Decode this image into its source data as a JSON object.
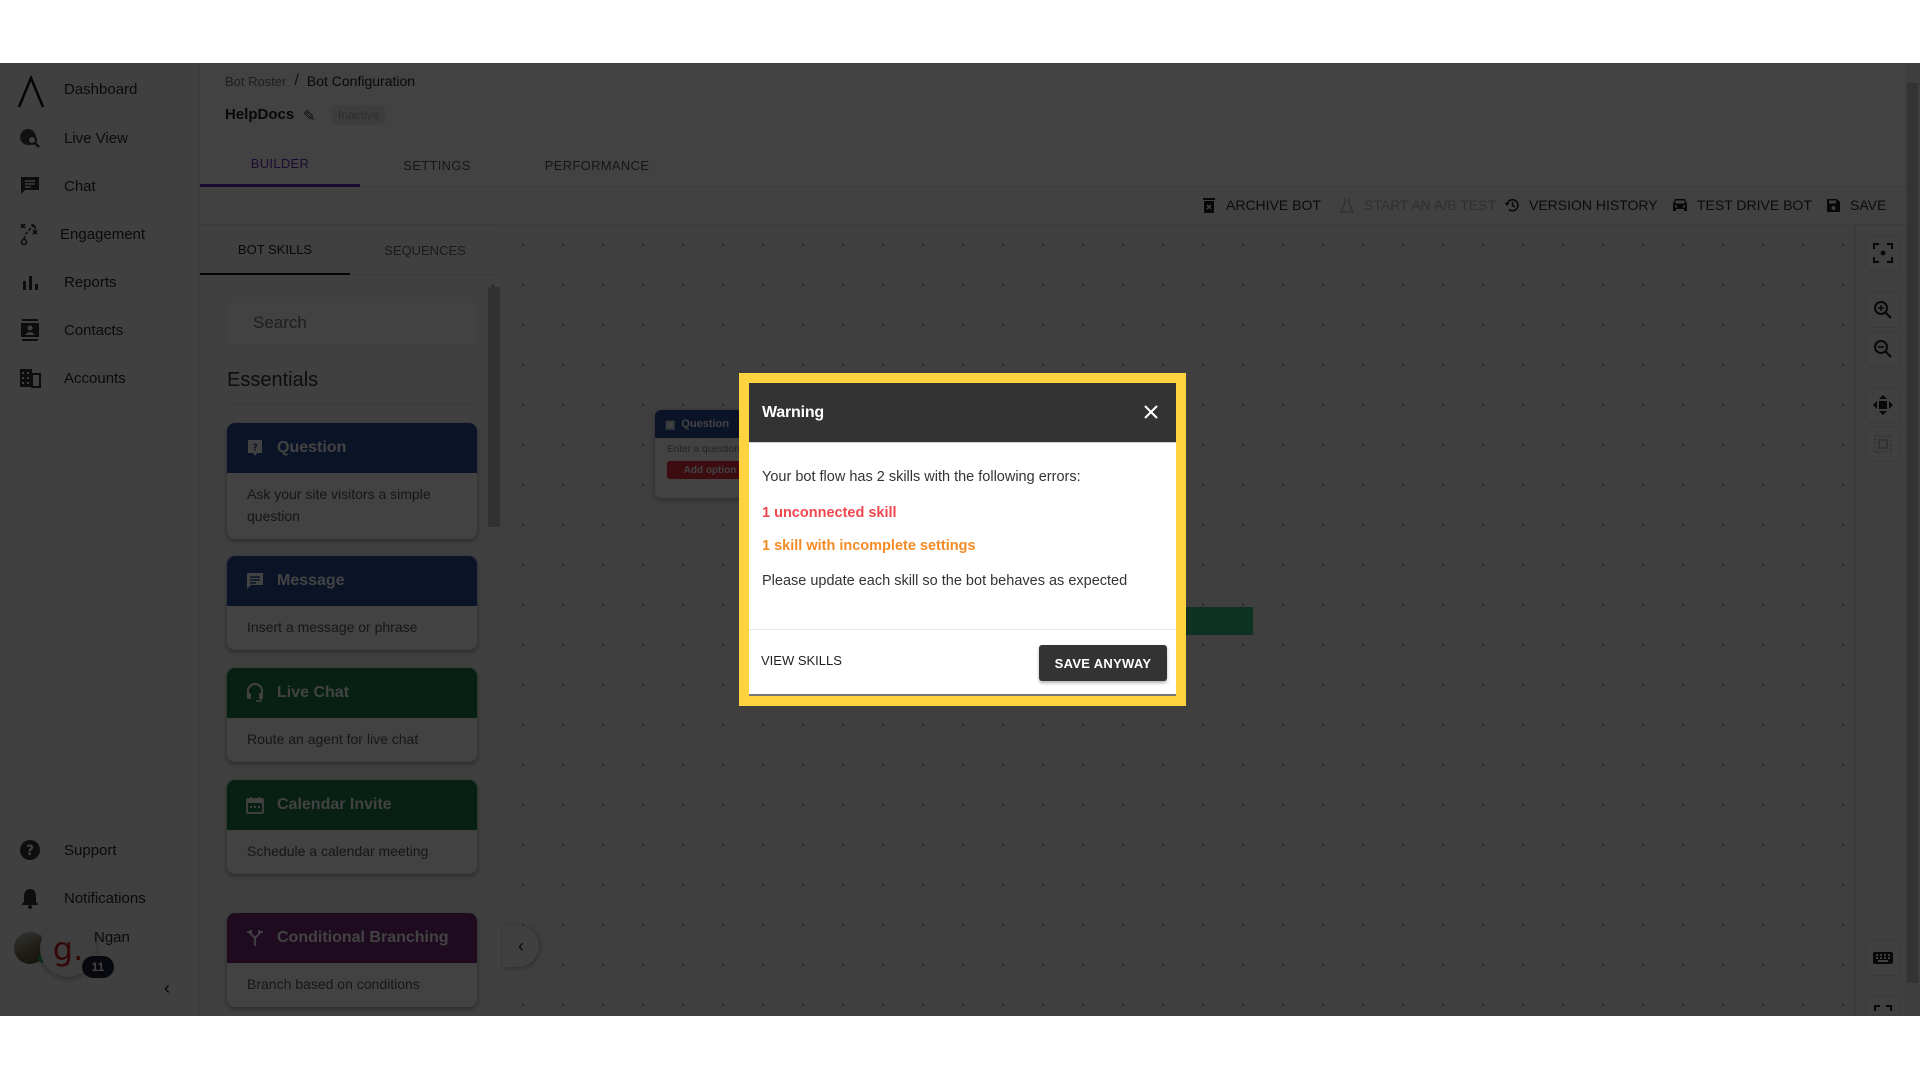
{
  "sidebar": {
    "items": [
      {
        "label": "Dashboard",
        "icon": "logo-caret-icon"
      },
      {
        "label": "Live View",
        "icon": "globe-search-icon"
      },
      {
        "label": "Chat",
        "icon": "chat-icon"
      },
      {
        "label": "Engagement",
        "icon": "strategy-icon"
      },
      {
        "label": "Reports",
        "icon": "bar-chart-icon"
      },
      {
        "label": "Contacts",
        "icon": "contact-card-icon"
      },
      {
        "label": "Accounts",
        "icon": "building-icon"
      }
    ],
    "bottom_items": [
      {
        "label": "Support",
        "icon": "help-icon"
      },
      {
        "label": "Notifications",
        "icon": "bell-icon"
      }
    ],
    "user_name": "Ngan",
    "widget_letter": "g.",
    "widget_badge": "11",
    "collapse_glyph": "‹"
  },
  "header": {
    "breadcrumb": [
      "Bot Roster",
      "Bot Configuration"
    ],
    "breadcrumb_sep": "/",
    "bot_name": "HelpDocs",
    "status": "Inactive",
    "tabs": [
      {
        "label": "BUILDER",
        "active": true
      },
      {
        "label": "SETTINGS",
        "active": false
      },
      {
        "label": "PERFORMANCE",
        "active": false
      }
    ]
  },
  "toolbar": {
    "archive": "ARCHIVE BOT",
    "ab_test": "START AN A/B TEST",
    "version_history": "VERSION HISTORY",
    "test_drive": "TEST DRIVE BOT",
    "save": "SAVE"
  },
  "skills_panel": {
    "tabs": [
      {
        "label": "BOT SKILLS",
        "active": true
      },
      {
        "label": "SEQUENCES",
        "active": false
      }
    ],
    "search_placeholder": "Search",
    "section_title": "Essentials",
    "skills": [
      {
        "title": "Question",
        "description": "Ask your site visitors a simple question",
        "color": "#2d4f94",
        "icon": "question-icon"
      },
      {
        "title": "Message",
        "description": "Insert a message or phrase",
        "color": "#2d4f94",
        "icon": "message-icon"
      },
      {
        "title": "Live Chat",
        "description": "Route an agent for live chat",
        "color": "#1f7a4b",
        "icon": "headset-icon"
      },
      {
        "title": "Calendar Invite",
        "description": "Schedule a calendar meeting",
        "color": "#1f7a4b",
        "icon": "calendar-icon"
      },
      {
        "title": "Conditional Branching",
        "description": "Branch based on conditions",
        "color": "#7a2b78",
        "icon": "branch-icon"
      }
    ]
  },
  "canvas": {
    "node": {
      "title": "Question",
      "placeholder": "Enter a question",
      "button": "Add option"
    }
  },
  "modal": {
    "title": "Warning",
    "intro": "Your bot flow has 2 skills with the following errors:",
    "errors": [
      {
        "text": "1 unconnected skill",
        "color": "#f0474f"
      },
      {
        "text": "1 skill with incomplete settings",
        "color": "#f58b25"
      }
    ],
    "footer_note": "Please update each skill so the bot behaves as expected",
    "secondary_button": "VIEW SKILLS",
    "primary_button": "SAVE ANYWAY",
    "highlight_color": "#ffd23f"
  }
}
